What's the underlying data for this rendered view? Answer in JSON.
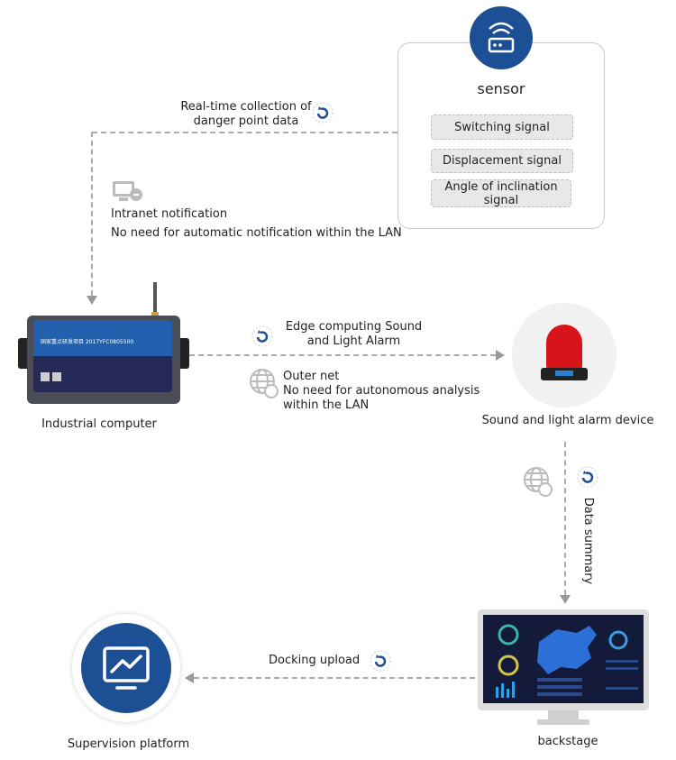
{
  "colors": {
    "primary": "#1d4f94",
    "line": "#aaaaaa",
    "pill": "#e8e8e8",
    "device_dark": "#242a55"
  },
  "sensor": {
    "title": "sensor",
    "icon": "router-icon",
    "signals": [
      "Switching signal",
      "Displacement signal",
      "Angle of inclination signal"
    ]
  },
  "collection": {
    "line1": "Real-time collection of",
    "line2": "danger point data",
    "icon": "refresh-icon"
  },
  "intranet": {
    "icon": "monitor-notification-icon",
    "title": "Intranet notification",
    "desc": "No need for automatic notification within the LAN"
  },
  "industrial_computer": {
    "label": "Industrial computer",
    "device_text": "国家重点研发项目  2017YFC0805500"
  },
  "edge": {
    "line1": "Edge computing Sound",
    "line2": "and Light Alarm",
    "icon": "refresh-icon"
  },
  "outer": {
    "icon": "globe-icon",
    "title": "Outer net",
    "line1": "No need for autonomous analysis",
    "line2": "within the LAN"
  },
  "alarm": {
    "label": "Sound and light alarm device"
  },
  "summary": {
    "label": "Data summary",
    "icons": [
      "globe-icon",
      "refresh-icon"
    ]
  },
  "backstage": {
    "label": "backstage"
  },
  "docking": {
    "label": "Docking upload",
    "icon": "refresh-icon"
  },
  "supervision": {
    "label": "Supervision platform",
    "icon": "chart-monitor-icon"
  }
}
